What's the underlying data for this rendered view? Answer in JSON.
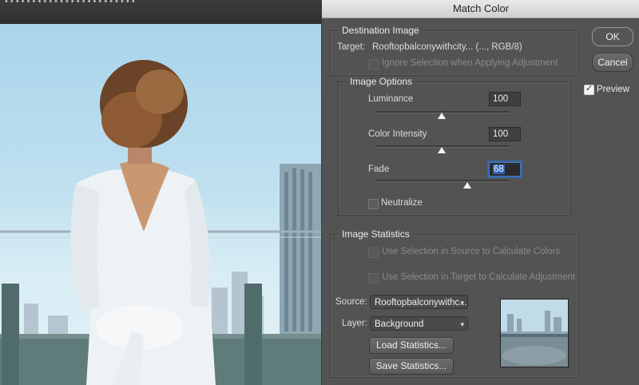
{
  "app": {
    "topbar_text": "• • • • • • • • • • • • • • • • • • • • • • • •"
  },
  "dialog": {
    "title": "Match Color",
    "ok_label": "OK",
    "cancel_label": "Cancel",
    "preview_label": "Preview",
    "preview_checked": true,
    "destination": {
      "legend": "Destination Image",
      "target_label": "Target:",
      "target_value": "Rooftopbalconywithcity... (..., RGB/8)",
      "ignore_selection_label": "Ignore Selection when Applying Adjustment"
    },
    "image_options": {
      "legend": "Image Options",
      "luminance_label": "Luminance",
      "luminance_value": "100",
      "color_intensity_label": "Color Intensity",
      "color_intensity_value": "100",
      "fade_label": "Fade",
      "fade_value": "68",
      "neutralize_label": "Neutralize"
    },
    "image_statistics": {
      "legend": "Image Statistics",
      "use_source_label": "Use Selection in Source to Calculate Colors",
      "use_target_label": "Use Selection in Target to Calculate Adjustment",
      "source_label": "Source:",
      "source_value": "Rooftopbalconywithc...",
      "layer_label": "Layer:",
      "layer_value": "Background",
      "load_label": "Load Statistics...",
      "save_label": "Save Statistics..."
    }
  }
}
